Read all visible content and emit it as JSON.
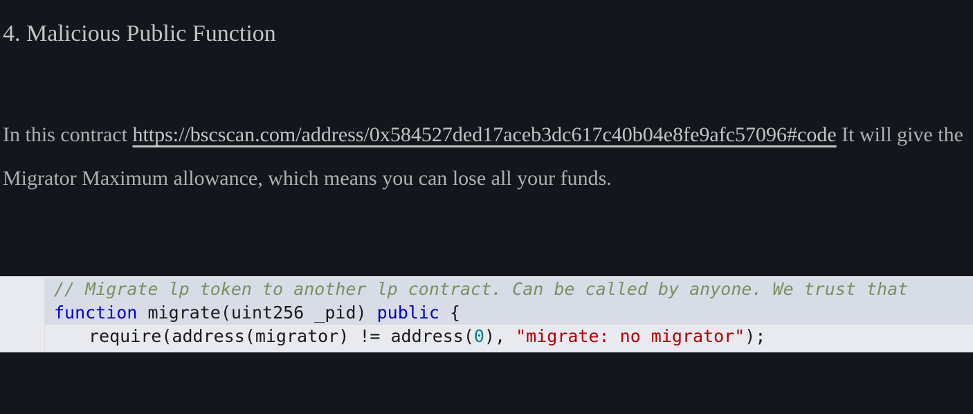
{
  "heading": "4. Malicious Public Function",
  "paragraph": {
    "intro": "In this contract ",
    "link_text": "https://bscscan.com/address/0x584527ded17aceb3dc617c40b04e8fe9afc57096#code",
    "rest": " It will give the Migrator Maximum allowance, which means you can lose all your funds."
  },
  "code": {
    "comment": "// Migrate lp token to another lp contract. Can be called by anyone. We trust that ",
    "line2_prefix": "function ",
    "line2_func": "migrate(uint256 _pid) ",
    "line2_public": "public",
    "line2_brace": " {",
    "line3_prefix": "require(address(migrator) != address(",
    "line3_zero": "0",
    "line3_mid": "), ",
    "line3_string": "\"migrate: no migrator\"",
    "line3_end": ");"
  }
}
